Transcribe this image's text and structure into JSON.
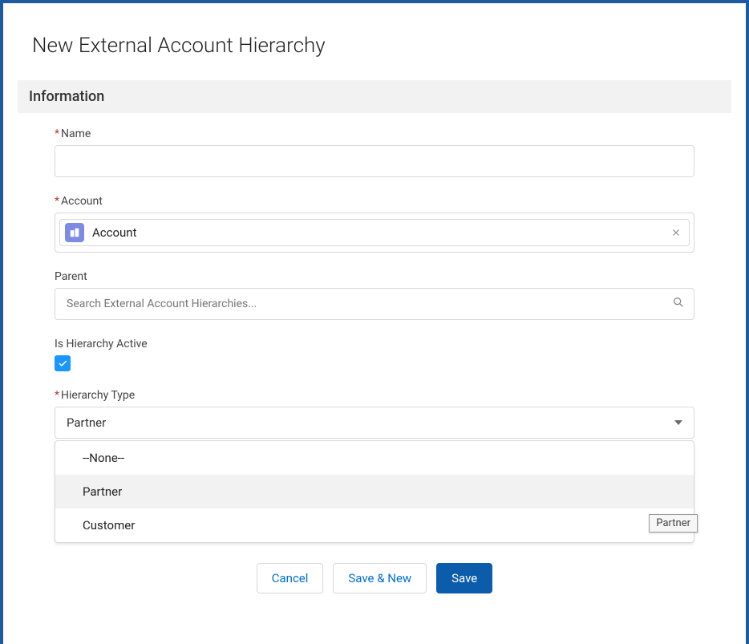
{
  "title": "New External Account Hierarchy",
  "section": "Information",
  "fields": {
    "name": {
      "label": "Name",
      "value": ""
    },
    "account": {
      "label": "Account",
      "pill": "Account"
    },
    "parent": {
      "label": "Parent",
      "placeholder": "Search External Account Hierarchies..."
    },
    "active": {
      "label": "Is Hierarchy Active"
    },
    "type": {
      "label": "Hierarchy Type",
      "selected": "Partner",
      "options": {
        "none": "--None--",
        "partner": "Partner",
        "customer": "Customer"
      }
    }
  },
  "tooltip": "Partner",
  "buttons": {
    "cancel": "Cancel",
    "saveNew": "Save & New",
    "save": "Save"
  }
}
